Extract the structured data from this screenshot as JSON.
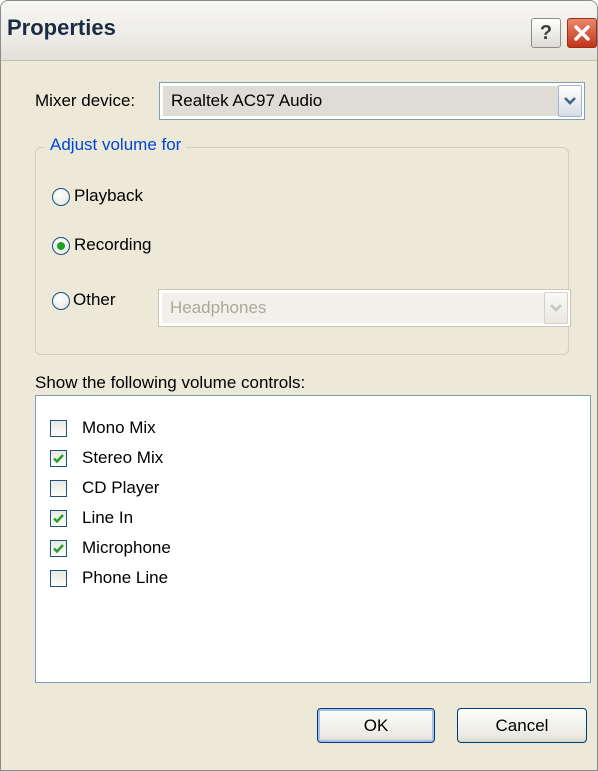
{
  "window": {
    "title": "Properties",
    "help_label": "?"
  },
  "mixer": {
    "label": "Mixer device:",
    "value": "Realtek AC97 Audio"
  },
  "adjust": {
    "legend": "Adjust volume for",
    "options": [
      {
        "label": "Playback",
        "checked": false
      },
      {
        "label": "Recording",
        "checked": true
      },
      {
        "label": "Other",
        "checked": false
      }
    ],
    "other_value": "Headphones"
  },
  "controls": {
    "label": "Show the following volume controls:",
    "items": [
      {
        "label": "Mono Mix",
        "checked": false
      },
      {
        "label": "Stereo Mix",
        "checked": true
      },
      {
        "label": "CD Player",
        "checked": false
      },
      {
        "label": "Line In",
        "checked": true
      },
      {
        "label": "Microphone",
        "checked": true
      },
      {
        "label": "Phone Line",
        "checked": false
      }
    ]
  },
  "buttons": {
    "ok": "OK",
    "cancel": "Cancel"
  },
  "colors": {
    "accent": "#0046d5",
    "check": "#21a121",
    "face": "#ece9d8"
  }
}
